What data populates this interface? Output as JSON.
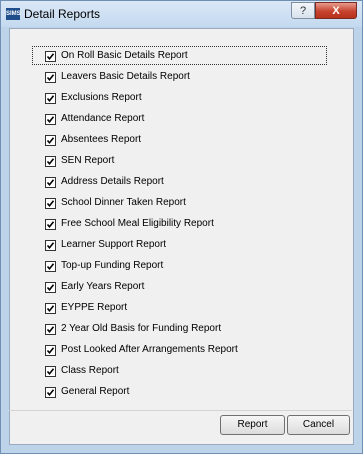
{
  "window": {
    "title": "Detail Reports",
    "app_icon_text": "SIMS",
    "help_label": "?",
    "close_label": "X"
  },
  "reports": [
    {
      "label": "On Roll Basic Details Report",
      "checked": true
    },
    {
      "label": "Leavers Basic Details Report",
      "checked": true
    },
    {
      "label": "Exclusions Report",
      "checked": true
    },
    {
      "label": "Attendance Report",
      "checked": true
    },
    {
      "label": "Absentees Report",
      "checked": true
    },
    {
      "label": "SEN Report",
      "checked": true
    },
    {
      "label": "Address Details Report",
      "checked": true
    },
    {
      "label": "School Dinner Taken Report",
      "checked": true
    },
    {
      "label": "Free School Meal Eligibility Report",
      "checked": true
    },
    {
      "label": "Learner Support Report",
      "checked": true
    },
    {
      "label": "Top-up Funding Report",
      "checked": true
    },
    {
      "label": "Early Years Report",
      "checked": true
    },
    {
      "label": "EYPPE Report",
      "checked": true
    },
    {
      "label": "2 Year Old Basis for Funding Report",
      "checked": true
    },
    {
      "label": "Post Looked After Arrangements Report",
      "checked": true
    },
    {
      "label": "Class Report",
      "checked": true
    },
    {
      "label": "General Report",
      "checked": true
    }
  ],
  "buttons": {
    "report_label": "Report",
    "cancel_label": "Cancel"
  }
}
